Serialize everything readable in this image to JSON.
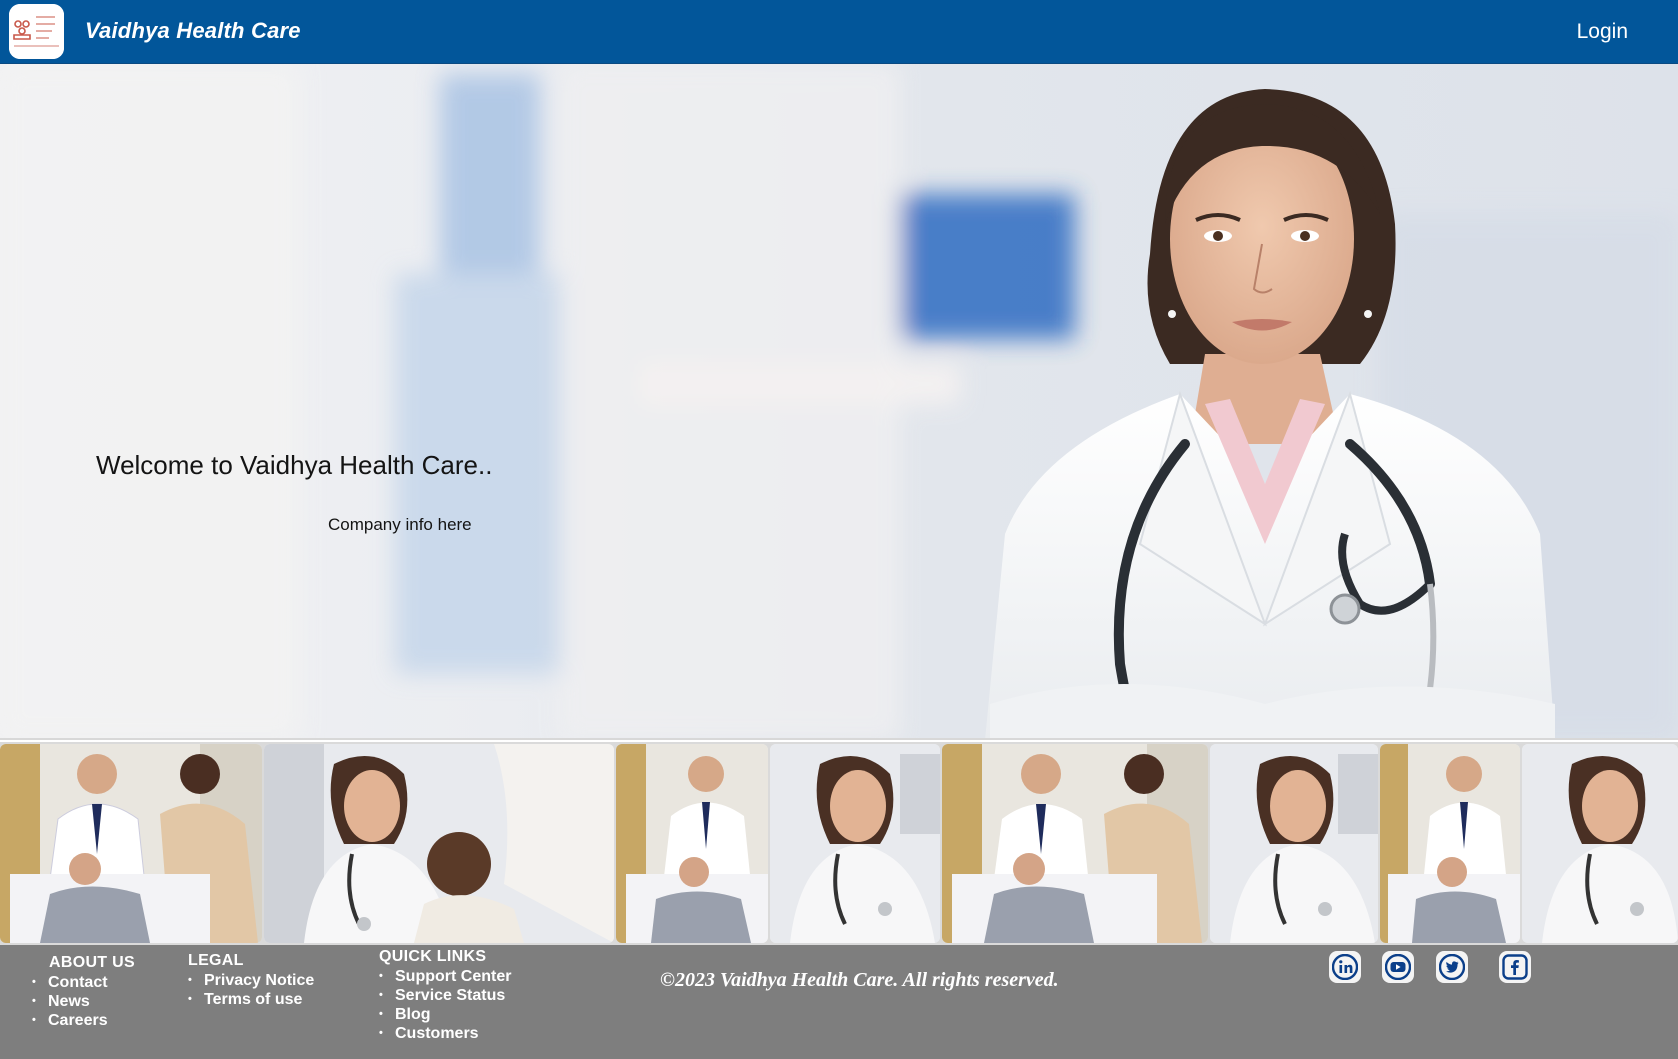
{
  "header": {
    "brand": "Vaidhya Health Care",
    "login_label": "Login",
    "logo_text": "Vaidhya Health Care"
  },
  "hero": {
    "welcome": "Welcome to Vaidhya Health Care..",
    "company_info": "Company info here"
  },
  "footer": {
    "about": {
      "heading": "ABOUT US",
      "items": [
        "Contact",
        "News",
        "Careers"
      ]
    },
    "legal": {
      "heading": "LEGAL",
      "items": [
        "Privacy Notice",
        "Terms of use"
      ]
    },
    "quick_links": {
      "heading": "QUICK LINKS",
      "items": [
        "Support Center",
        "Service Status",
        "Blog",
        "Customers"
      ]
    },
    "copyright": "©2023 Vaidhya Health Care. All rights reserved.",
    "social": [
      "linkedin-icon",
      "youtube-icon",
      "twitter-icon",
      "facebook-icon"
    ]
  },
  "colors": {
    "header": "#02569a",
    "footer": "#7e7e7e",
    "social_icon": "#0b3f8a"
  }
}
